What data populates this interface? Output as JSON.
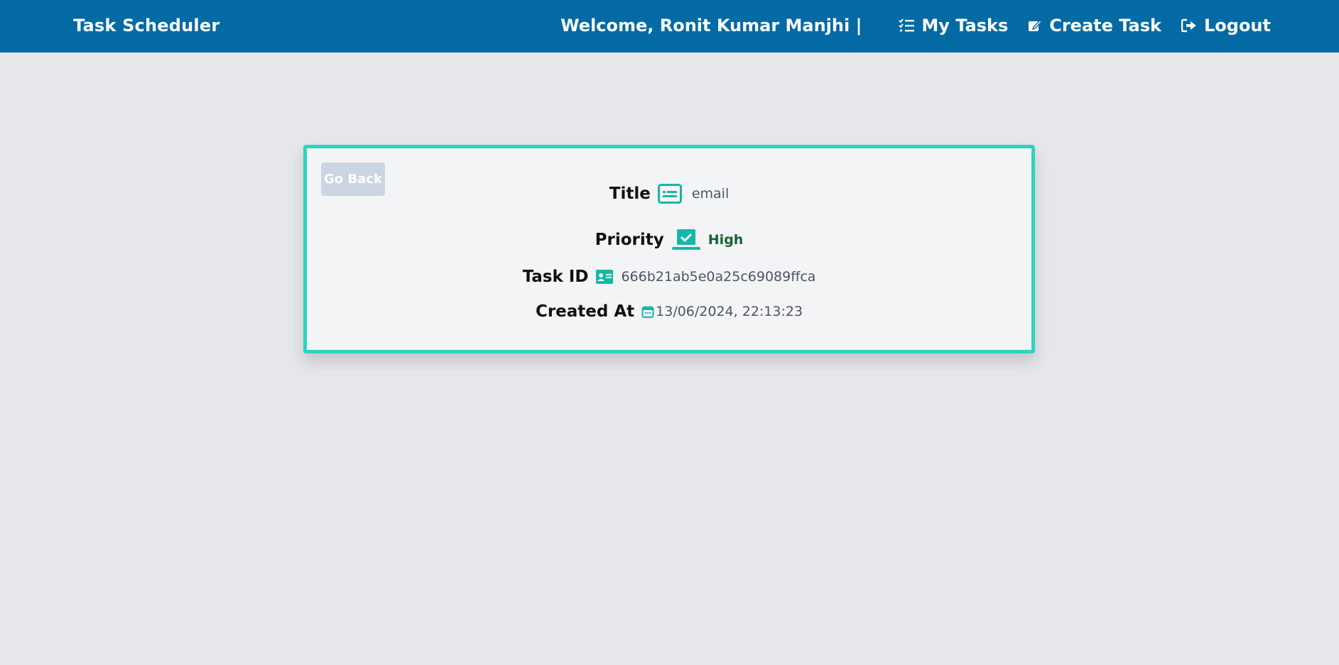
{
  "navbar": {
    "brand": "Task Scheduler",
    "welcome": "Welcome, Ronit Kumar Manjhi |",
    "links": [
      {
        "label": "My Tasks",
        "icon": "list-check-icon"
      },
      {
        "label": "Create Task",
        "icon": "pen-to-square-icon"
      },
      {
        "label": "Logout",
        "icon": "logout-icon"
      }
    ]
  },
  "task": {
    "back_label": "Go Back",
    "title_label": "Title",
    "title_value": "email",
    "priority_label": "Priority",
    "priority_value": "High",
    "id_label": "Task ID",
    "id_value": "666b21ab5e0a25c69089ffca",
    "created_label": "Created At",
    "created_value": "13/06/2024, 22:13:23"
  },
  "colors": {
    "navbar": "#036aa4",
    "accent": "#2dd4bf",
    "icon": "#14b8a6",
    "priority_high": "#166534",
    "background": "#e5e7eb",
    "card": "#f3f4f6"
  }
}
